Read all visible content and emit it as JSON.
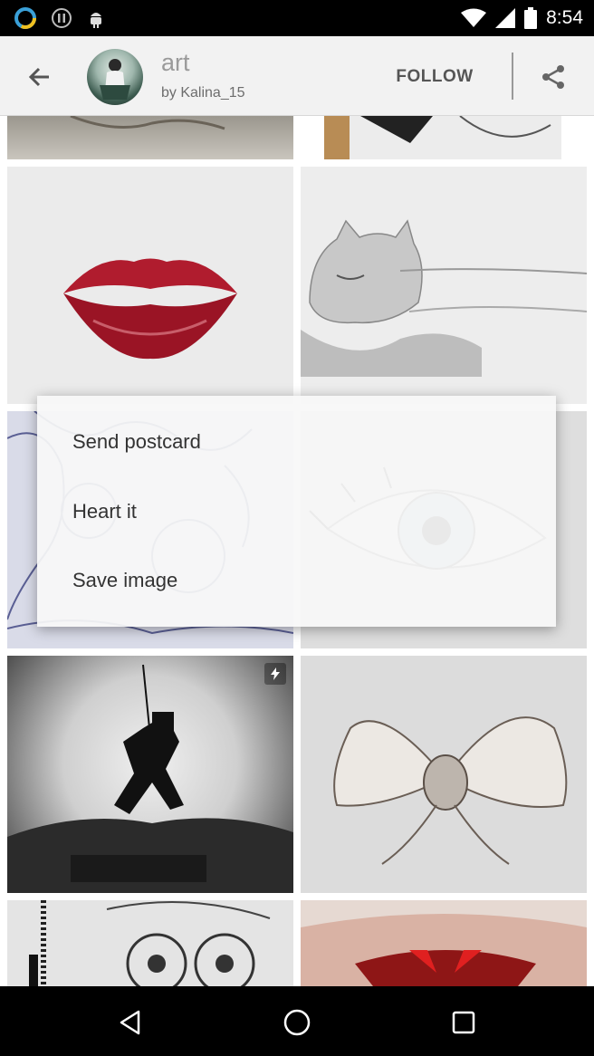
{
  "status_bar": {
    "time": "8:54",
    "icons": [
      "ring-notification-icon",
      "pause-circle-icon",
      "android-icon",
      "wifi-icon",
      "cellular-icon",
      "battery-icon"
    ]
  },
  "app_bar": {
    "title": "art",
    "subtitle": "by Kalina_15",
    "follow_label": "FOLLOW",
    "icons": [
      "back-arrow-icon",
      "share-icon"
    ]
  },
  "context_menu": {
    "items": [
      {
        "label": "Send postcard"
      },
      {
        "label": "Heart it"
      },
      {
        "label": "Save image"
      }
    ]
  },
  "grid": {
    "tiles": [
      {
        "name": "artwork-top-left-partial"
      },
      {
        "name": "artwork-top-right-partial"
      },
      {
        "name": "artwork-lips"
      },
      {
        "name": "artwork-sleeping-cat"
      },
      {
        "name": "artwork-doodle-dreams"
      },
      {
        "name": "artwork-eye"
      },
      {
        "name": "artwork-knight-moon",
        "badge": "bolt-icon"
      },
      {
        "name": "artwork-bow"
      },
      {
        "name": "artwork-owl"
      },
      {
        "name": "artwork-red-face"
      }
    ]
  },
  "nav_bar": {
    "icons": [
      "back-triangle-icon",
      "home-circle-icon",
      "recents-square-icon"
    ]
  },
  "colors": {
    "status_bar_bg": "#000000",
    "app_bar_bg": "#f2f2f2",
    "title_color": "#9a9a9a",
    "menu_bg": "#f8f8f8",
    "menu_text": "#333333"
  }
}
